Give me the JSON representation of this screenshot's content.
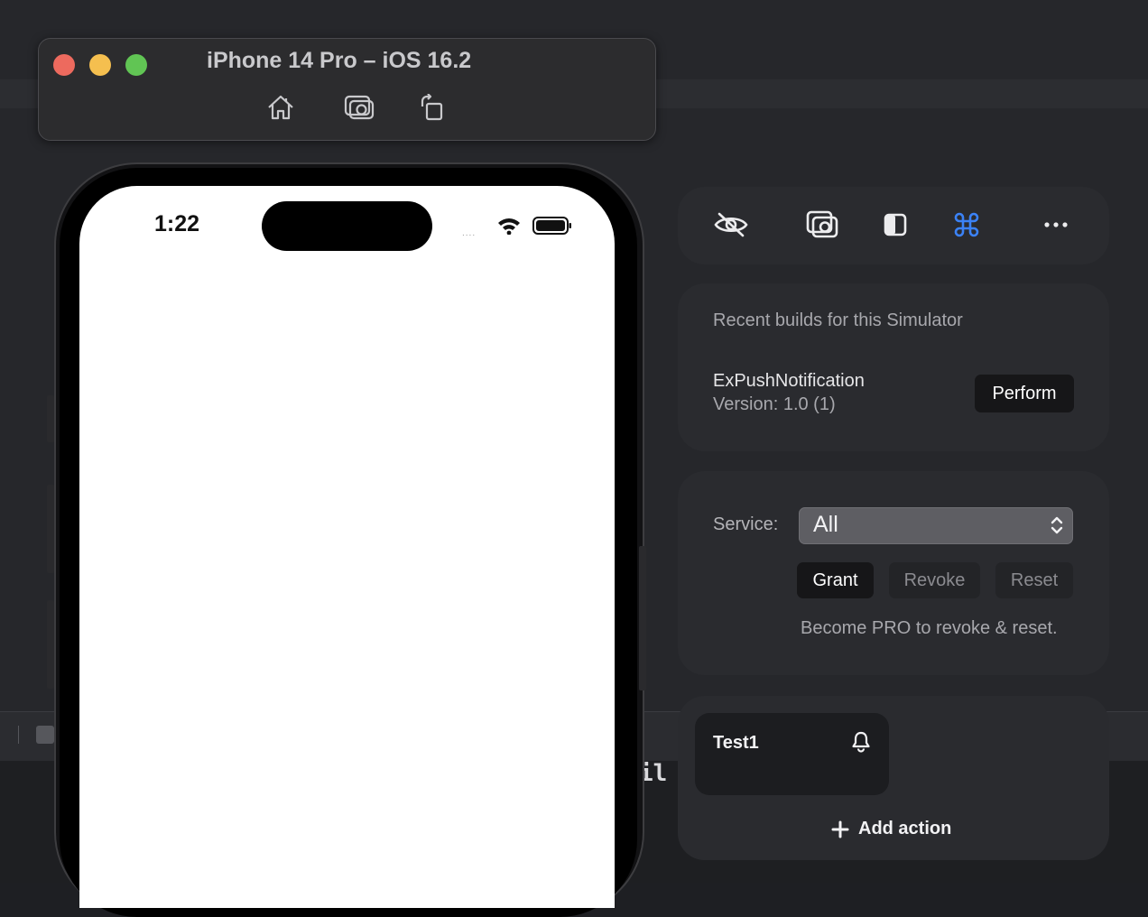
{
  "simulator": {
    "title": "iPhone 14 Pro – iOS 16.2",
    "tools": [
      "home-icon",
      "screenshot-icon",
      "rotate-icon"
    ]
  },
  "phone": {
    "status_time": "1:22",
    "status_signal": "....",
    "screen_color": "#ffffff"
  },
  "toolbar": {
    "icons": [
      "hide-icon",
      "screenshot-icon",
      "appearance-icon",
      "command-icon",
      "more-icon"
    ],
    "accent": "#3b82f6"
  },
  "builds": {
    "heading": "Recent builds for this Simulator",
    "app_name": "ExPushNotification",
    "version": "Version: 1.0 (1)",
    "perform_label": "Perform"
  },
  "permissions": {
    "service_label": "Service:",
    "service_value": "All",
    "grant_label": "Grant",
    "revoke_label": "Revoke",
    "reset_label": "Reset",
    "pro_note": "Become PRO to revoke & reset."
  },
  "actions": {
    "items": [
      {
        "name": "Test1",
        "icon": "bell-icon"
      }
    ],
    "add_label": "Add action"
  },
  "background": {
    "code_fragment": "il"
  }
}
